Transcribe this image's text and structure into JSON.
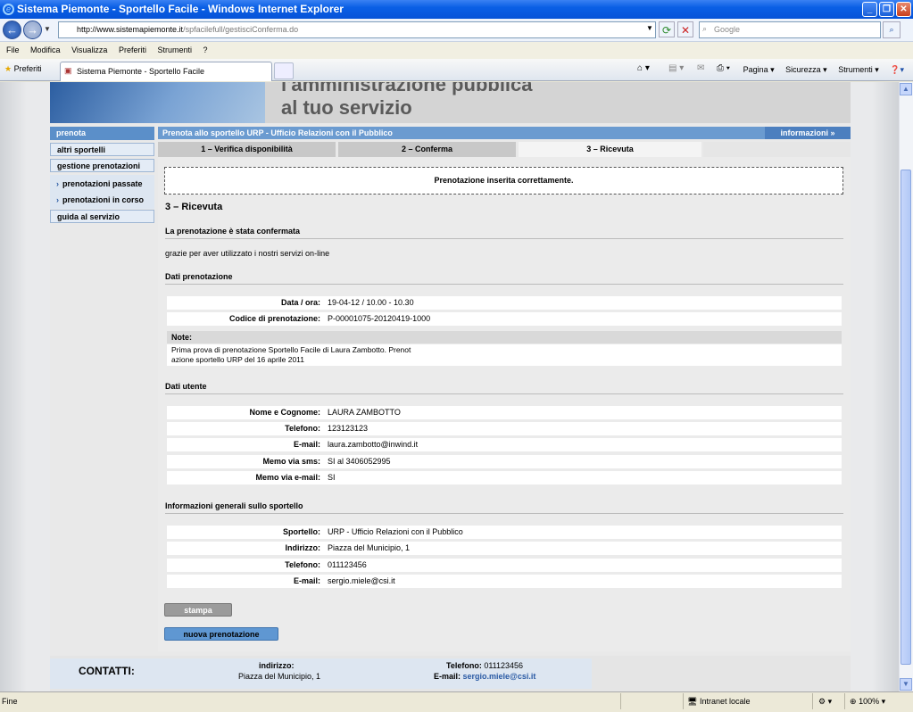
{
  "window": {
    "title": "Sistema Piemonte - Sportello Facile - Windows Internet Explorer"
  },
  "address": {
    "host": "http://www.sistemapiemonte.it",
    "path": "/spfacilefull/gestisciConferma.do"
  },
  "search": {
    "placeholder": "Google"
  },
  "menu": [
    "File",
    "Modifica",
    "Visualizza",
    "Preferiti",
    "Strumenti",
    "?"
  ],
  "favorites_label": "Preferiti",
  "tab": {
    "title": "Sistema Piemonte - Sportello Facile"
  },
  "tools": [
    "Pagina ▾",
    "Sicurezza ▾",
    "Strumenti ▾"
  ],
  "banner": {
    "line1": "l'amministrazione pubblica",
    "line2": "al tuo servizio"
  },
  "sidebar": {
    "prenota": "prenota",
    "altri": "altri sportelli",
    "gestione": "gestione prenotazioni",
    "passate": "prenotazioni passate",
    "incorso": "prenotazioni in corso",
    "guida": "guida al servizio"
  },
  "crumb": "Prenota allo sportello URP - Ufficio Relazioni con il Pubblico",
  "info_label": "informazioni »",
  "steps": [
    "1 – Verifica disponibilità",
    "2 – Conferma",
    "3 – Ricevuta"
  ],
  "message": "Prenotazione inserita correttamente.",
  "heading": "3 – Ricevuta",
  "confirm_title": "La prenotazione è stata confermata",
  "thanks": "grazie per aver utilizzato i nostri servizi on-line",
  "dati_prenotazione": {
    "title": "Dati prenotazione",
    "rows": [
      {
        "label": "Data / ora:",
        "value": "19-04-12 / 10.00 - 10.30"
      },
      {
        "label": "Codice di prenotazione:",
        "value": "P-00001075-20120419-1000"
      }
    ],
    "note_label": "Note:",
    "note_line1": "Prima prova di prenotazione Sportello Facile di Laura Zambotto. Prenot",
    "note_line2": "azione sportello URP del 16 aprile 2011"
  },
  "dati_utente": {
    "title": "Dati utente",
    "rows": [
      {
        "label": "Nome e Cognome:",
        "value": "LAURA ZAMBOTTO"
      },
      {
        "label": "Telefono:",
        "value": "123123123"
      },
      {
        "label": "E-mail:",
        "value": "laura.zambotto@inwind.it"
      },
      {
        "label": "Memo via sms:",
        "value": "SI al 3406052995"
      },
      {
        "label": "Memo via e-mail:",
        "value": "SI"
      }
    ]
  },
  "info_sportello": {
    "title": "Informazioni generali sullo sportello",
    "rows": [
      {
        "label": "Sportello:",
        "value": "URP - Ufficio Relazioni con il Pubblico"
      },
      {
        "label": "Indirizzo:",
        "value": "Piazza del Municipio, 1"
      },
      {
        "label": "Telefono:",
        "value": "011123456"
      },
      {
        "label": "E-mail:",
        "value": "sergio.miele@csi.it"
      }
    ]
  },
  "buttons": {
    "stampa": "stampa",
    "nuova": "nuova prenotazione"
  },
  "footer": {
    "contatti": "CONTATTI:",
    "indirizzo_label": "indirizzo:",
    "indirizzo": "Piazza del Municipio, 1",
    "telefono_label": "Telefono:",
    "telefono": "011123456",
    "email_label": "E-mail:",
    "email": "sergio.miele@csi.it"
  },
  "status": {
    "text": "Fine",
    "zone": "Intranet locale",
    "zoom": "100%"
  },
  "colors": {
    "accent": "#6b9bd0",
    "titlebar": "#0a5fe5"
  }
}
